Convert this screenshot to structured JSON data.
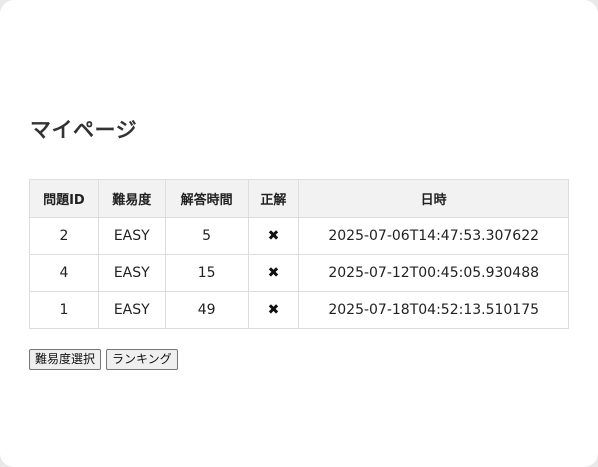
{
  "page": {
    "title": "マイページ"
  },
  "table": {
    "headers": [
      "問題ID",
      "難易度",
      "解答時間",
      "正解",
      "日時"
    ],
    "rows": [
      {
        "id": "2",
        "difficulty": "EASY",
        "time": "5",
        "correct": "✖",
        "datetime": "2025-07-06T14:47:53.307622"
      },
      {
        "id": "4",
        "difficulty": "EASY",
        "time": "15",
        "correct": "✖",
        "datetime": "2025-07-12T00:45:05.930488"
      },
      {
        "id": "1",
        "difficulty": "EASY",
        "time": "49",
        "correct": "✖",
        "datetime": "2025-07-18T04:52:13.510175"
      }
    ]
  },
  "buttons": {
    "difficulty_select": "難易度選択",
    "ranking": "ランキング"
  }
}
